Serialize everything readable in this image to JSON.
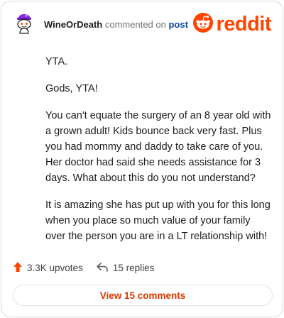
{
  "comment": {
    "username": "WineOrDeath",
    "action_text": "commented on",
    "target_text": "post",
    "paragraphs": [
      "YTA.",
      "Gods, YTA!",
      "You can't equate the surgery of an 8 year old with a grown adult! Kids bounce back very fast. Plus you had mommy and daddy to take care of you. Her doctor had said she needs assistance for 3 days. What about this do you not understand?",
      "It is amazing she has put up with you for this long when you place so much value of your family over the person you are in a LT relationship with!"
    ]
  },
  "brand": {
    "wordmark": "reddit",
    "color": "#ff4500"
  },
  "stats": {
    "upvotes": "3.3K upvotes",
    "replies": "15 replies"
  },
  "actions": {
    "view_comments_label": "View 15 comments"
  },
  "icons": {
    "avatar": "snoo-avatar-icon",
    "logo": "reddit-logo-icon",
    "upvote": "upvote-arrow-icon",
    "reply": "reply-arrow-icon"
  },
  "colors": {
    "accent": "#ff4500",
    "link": "#0a4a9e",
    "upvote": "#ff4500",
    "button_text": "#d93900"
  }
}
